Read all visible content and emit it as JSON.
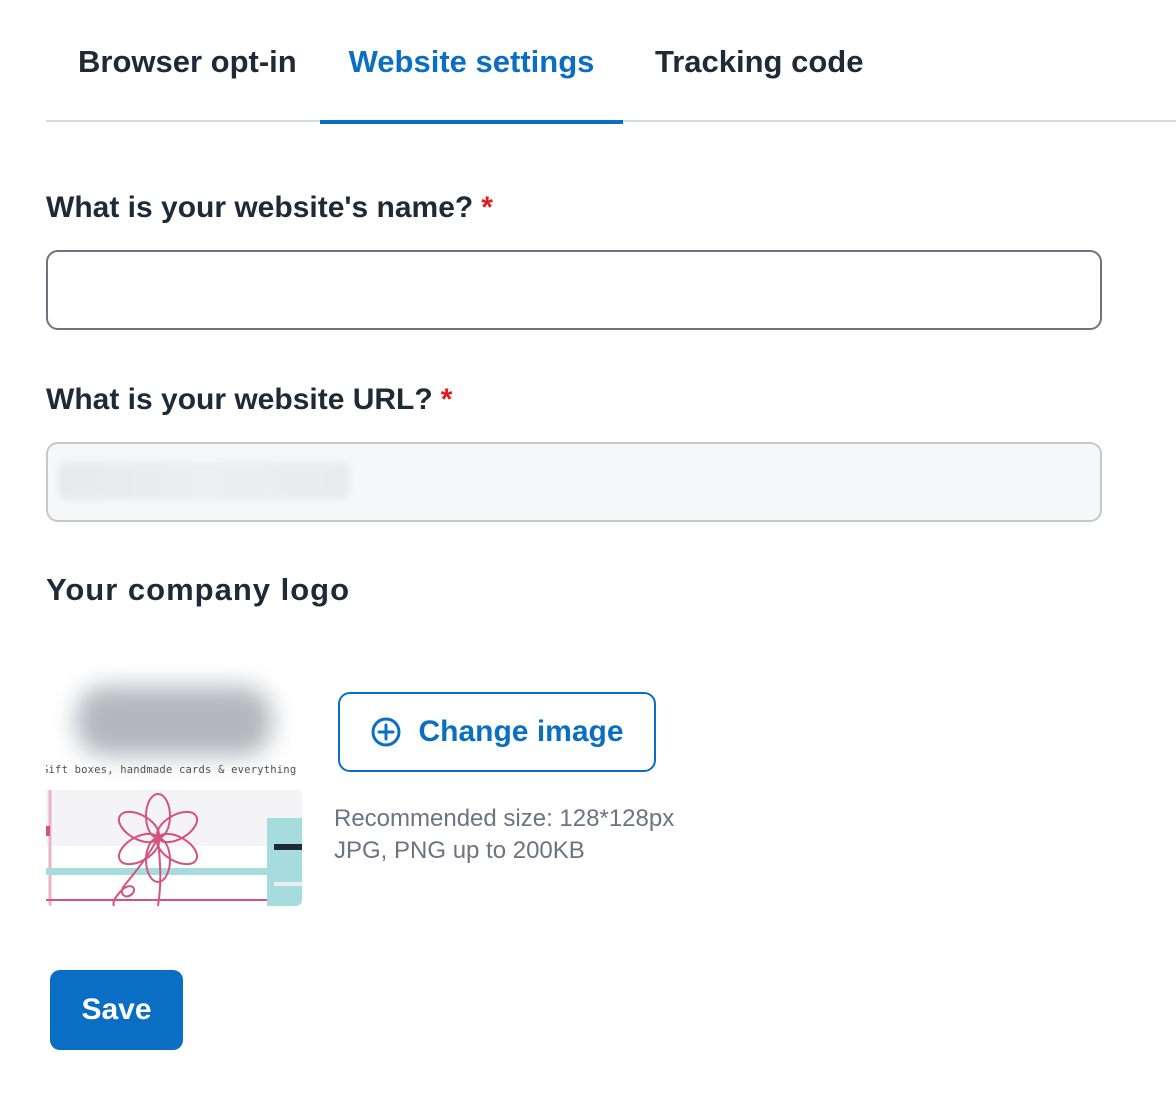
{
  "tabs": [
    {
      "label": "Browser opt-in",
      "active": false
    },
    {
      "label": "Website settings",
      "active": true
    },
    {
      "label": "Tracking code",
      "active": false
    }
  ],
  "form": {
    "name_label": "What is your website's name?",
    "name_value": "",
    "url_label": "What is your website URL?",
    "url_value": "",
    "required_mark": "*"
  },
  "logo": {
    "section_title": "Your company logo",
    "tagline": "Gift boxes, handmade cards & everything paper",
    "change_button_label": "Change image",
    "hint_size": "Recommended size: 128*128px",
    "hint_format": "JPG, PNG up to 200KB"
  },
  "actions": {
    "save_label": "Save"
  },
  "colors": {
    "accent": "#0a6fc4",
    "required": "#e01b1b",
    "text": "#1f2a37",
    "muted": "#6b7480"
  }
}
